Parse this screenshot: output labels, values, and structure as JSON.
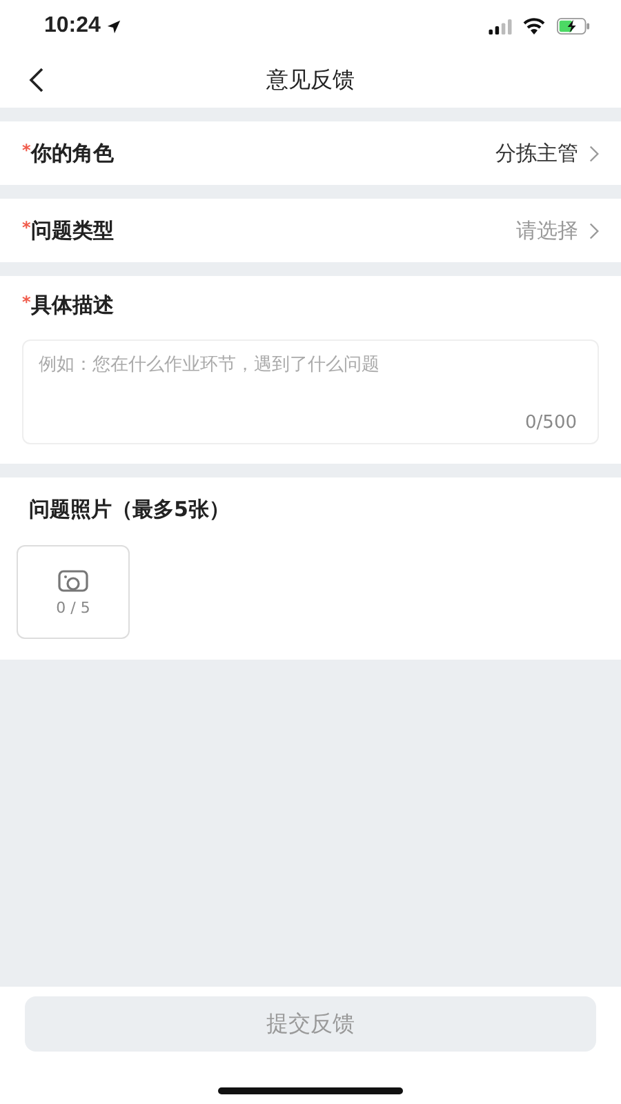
{
  "status_bar": {
    "time": "10:24"
  },
  "nav": {
    "title": "意见反馈"
  },
  "required_mark": "*",
  "select_rows": [
    {
      "label": "你的角色",
      "required": true,
      "value": "分拣主管"
    },
    {
      "label": "问题类型",
      "required": true,
      "placeholder": "请选择"
    }
  ],
  "description": {
    "label": "具体描述",
    "required": true,
    "placeholder": "例如：您在什么作业环节，遇到了什么问题",
    "counter": "0/500"
  },
  "photos": {
    "title": "问题照片（最多5张）",
    "upload_counter": "0 / 5"
  },
  "submit_button": {
    "label": "提交反馈",
    "disabled": true
  }
}
